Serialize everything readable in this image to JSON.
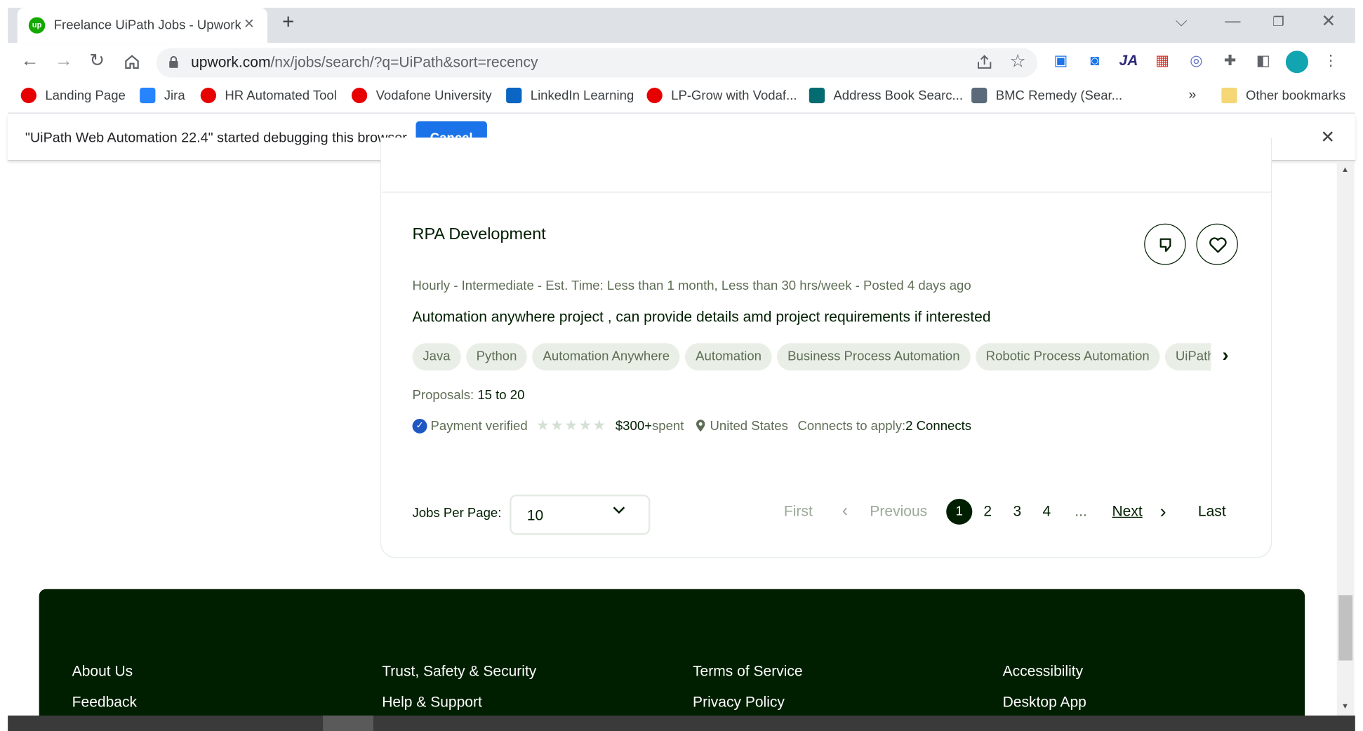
{
  "browser": {
    "tab_title": "Freelance UiPath Jobs - Upwork",
    "favicon_text": "up",
    "url_host": "upwork.com",
    "url_path": "/nx/jobs/search/?q=UiPath&sort=recency",
    "bookmarks": [
      {
        "label": "Landing Page",
        "icon": "vodafone-icon",
        "color": "#e60000"
      },
      {
        "label": "Jira",
        "icon": "jira-icon",
        "color": "#2684ff"
      },
      {
        "label": "HR Automated Tool",
        "icon": "vodafone-icon",
        "color": "#e60000"
      },
      {
        "label": "Vodafone University",
        "icon": "vodafone-icon",
        "color": "#e60000"
      },
      {
        "label": "LinkedIn Learning",
        "icon": "linkedin-learning-icon",
        "color": "#0a66c2"
      },
      {
        "label": "LP-Grow with Vodaf...",
        "icon": "vodafone-icon",
        "color": "#e60000"
      },
      {
        "label": "Address Book Searc...",
        "icon": "sharepoint-icon",
        "color": "#036c70"
      },
      {
        "label": "BMC Remedy (Sear...",
        "icon": "remedy-icon",
        "color": "#5a6a7a"
      }
    ],
    "bookmarks_overflow": "»",
    "other_bookmarks": "Other bookmarks"
  },
  "infobar": {
    "message": "\"UiPath Web Automation 22.4\" started debugging this browser",
    "cancel_label": "Cancel"
  },
  "job": {
    "title": "RPA Development",
    "type": "Hourly",
    "meta_rest": " - Intermediate - Est. Time: Less than 1 month, Less than 30 hrs/week - Posted 4 days ago",
    "description": "Automation anywhere project , can provide details amd project requirements if interested",
    "skills": [
      "Java",
      "Python",
      "Automation Anywhere",
      "Automation",
      "Business Process Automation",
      "Robotic Process Automation",
      "UiPath"
    ],
    "proposals_label": "Proposals: ",
    "proposals_value": "15 to 20",
    "payment": "Payment verified",
    "rating": 0,
    "spent_amount": "$300+",
    "spent_suffix": " spent",
    "location": "United States",
    "connects_label": "Connects to apply: ",
    "connects_value": "2 Connects"
  },
  "pagination": {
    "per_page_label": "Jobs Per Page:",
    "per_page_value": "10",
    "first": "First",
    "previous": "Previous",
    "pages": [
      "1",
      "2",
      "3",
      "4"
    ],
    "ellipsis": "...",
    "next": "Next",
    "last": "Last",
    "current_page": "1"
  },
  "footer": {
    "links": [
      "About Us",
      "Trust, Safety & Security",
      "Terms of Service",
      "Accessibility",
      "Feedback",
      "Help & Support",
      "Privacy Policy",
      "Desktop App"
    ]
  },
  "colors": {
    "brand_green": "#14a800",
    "footer_bg": "#001e00",
    "chip_bg": "#e9efe6",
    "cancel_blue": "#1a73e8"
  }
}
